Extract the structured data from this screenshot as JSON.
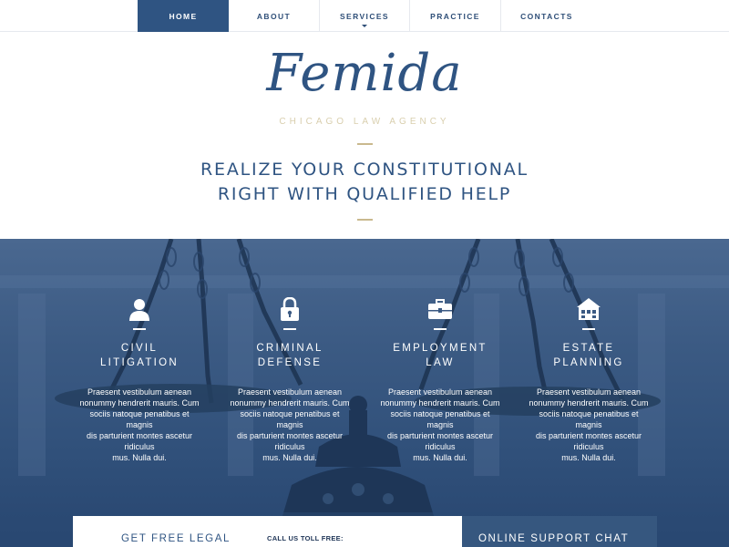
{
  "nav": {
    "items": [
      {
        "label": "HOME",
        "active": true
      },
      {
        "label": "ABOUT",
        "active": false
      },
      {
        "label": "SERVICES",
        "active": false,
        "has_dropdown": true
      },
      {
        "label": "PRACTICE",
        "active": false
      },
      {
        "label": "CONTACTS",
        "active": false
      }
    ]
  },
  "brand": {
    "logo": "Femida",
    "tagline": "CHICAGO LAW AGENCY"
  },
  "hero": {
    "line1": "REALIZE YOUR CONSTITUTIONAL",
    "line2": "RIGHT WITH QUALIFIED HELP"
  },
  "services": [
    {
      "icon": "person-icon",
      "title1": "CIVIL",
      "title2": "LITIGATION",
      "desc1": "Praesent vestibulum aenean",
      "desc2": "nonummy hendrerit mauris. Cum",
      "desc3": "sociis natoque penatibus et magnis",
      "desc4": "dis parturient montes ascetur ridiculus",
      "desc5": "mus. Nulla dui."
    },
    {
      "icon": "lock-icon",
      "title1": "CRIMINAL",
      "title2": "DEFENSE",
      "desc1": "Praesent vestibulum aenean",
      "desc2": "nonummy hendrerit mauris. Cum",
      "desc3": "sociis natoque penatibus et magnis",
      "desc4": "dis parturient montes ascetur ridiculus",
      "desc5": "mus. Nulla dui."
    },
    {
      "icon": "briefcase-icon",
      "title1": "EMPLOYMENT",
      "title2": "LAW",
      "desc1": "Praesent vestibulum aenean",
      "desc2": "nonummy hendrerit mauris. Cum",
      "desc3": "sociis natoque penatibus et magnis",
      "desc4": "dis parturient montes ascetur ridiculus",
      "desc5": "mus. Nulla dui."
    },
    {
      "icon": "house-icon",
      "title1": "ESTATE",
      "title2": "PLANNING",
      "desc1": "Praesent vestibulum aenean",
      "desc2": "nonummy hendrerit mauris. Cum",
      "desc3": "sociis natoque penatibus et magnis",
      "desc4": "dis parturient montes ascetur ridiculus",
      "desc5": "mus. Nulla dui."
    }
  ],
  "cta": {
    "title": "GET FREE LEGAL",
    "call_label": "CALL US TOLL FREE:"
  },
  "chat": {
    "title": "ONLINE SUPPORT CHAT"
  },
  "colors": {
    "primary": "#2f5482",
    "gold": "#c9b98e",
    "banner_overlay": "#3b5a83"
  }
}
